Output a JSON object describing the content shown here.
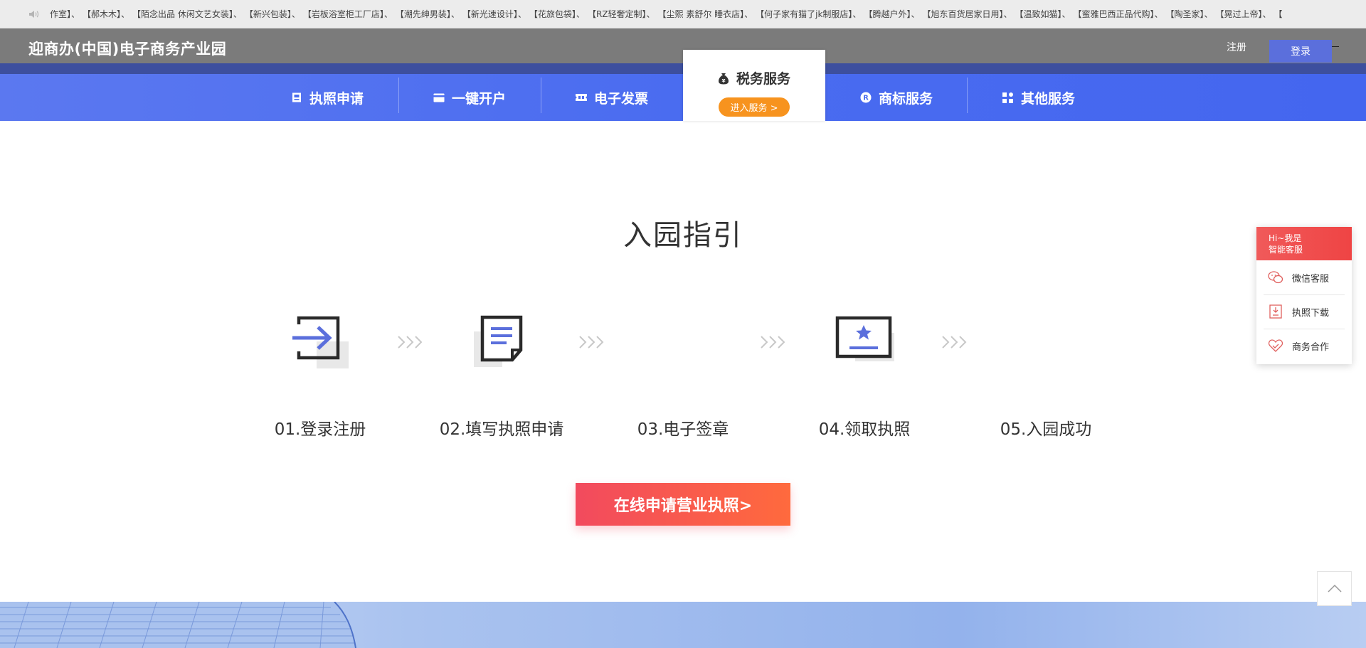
{
  "ticker": {
    "items": [
      "作室】、",
      "【郝木木】、",
      "【陌念出品 休闲文艺女装】、",
      "【新兴包装】、",
      "【岩板浴室柜工厂店】、",
      "【潮先绅男装】、",
      "【新光速设计】、",
      "【花旅包袋】、",
      "【RZ轻奢定制】、",
      "【尘熙 素舒尔 睡衣店】、",
      "【何子家有猫了jk制服店】、",
      "【腾越户外】、",
      "【旭东百货居家日用】、",
      "【温致如猫】、",
      "【蜜雅巴西正品代购】、",
      "【陶圣家】、",
      "【晃过上帝】、",
      "【"
    ]
  },
  "header": {
    "site_title": "迎商办(中国)电子商务产业园",
    "register": "注册",
    "login": "登录"
  },
  "nav": {
    "items": [
      {
        "label": "执照申请",
        "icon": "license-icon"
      },
      {
        "label": "一键开户",
        "icon": "card-icon"
      },
      {
        "label": "电子发票",
        "icon": "ticket-icon"
      },
      {
        "label": "税务服务",
        "icon": "money-bag-icon",
        "enter": "进入服务 >"
      },
      {
        "label": "商标服务",
        "icon": "registered-icon"
      },
      {
        "label": "其他服务",
        "icon": "grid-icon"
      }
    ]
  },
  "guide": {
    "title": "入园指引",
    "steps": [
      {
        "label": "01.登录注册",
        "icon": "login-arrow-icon"
      },
      {
        "label": "02.填写执照申请",
        "icon": "document-icon"
      },
      {
        "label": "03.电子签章",
        "icon": ""
      },
      {
        "label": "04.领取执照",
        "icon": "certificate-star-icon"
      },
      {
        "label": "05.入园成功",
        "icon": ""
      }
    ],
    "cta": "在线申请营业执照>"
  },
  "side": {
    "hi_line1": "Hi~我是",
    "hi_line2": "智能客服",
    "items": [
      {
        "label": "微信客服",
        "icon": "wechat-icon"
      },
      {
        "label": "执照下载",
        "icon": "download-icon"
      },
      {
        "label": "商务合作",
        "icon": "handshake-heart-icon"
      }
    ]
  },
  "colors": {
    "nav_blue": "#4a6cf0",
    "accent_orange": "#f7931e",
    "cta_red": "#f24a5e",
    "icon_blue": "#5b6fdc"
  }
}
